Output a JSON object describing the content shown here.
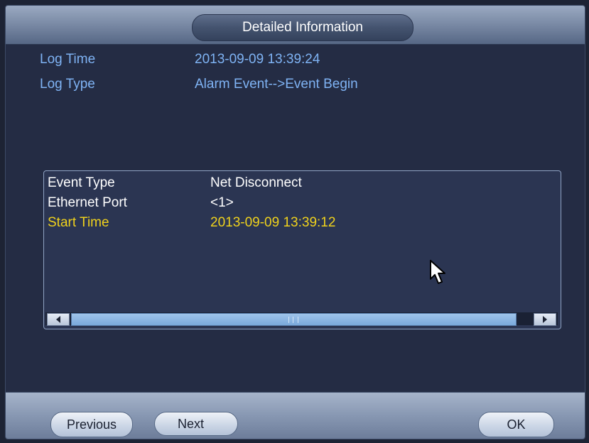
{
  "dialog": {
    "title": "Detailed Information"
  },
  "log_info": [
    {
      "label": "Log Time",
      "value": "2013-09-09 13:39:24"
    },
    {
      "label": "Log Type",
      "value": "Alarm Event-->Event Begin"
    }
  ],
  "details": [
    {
      "label": "Event Type",
      "value": "Net Disconnect",
      "highlighted": false
    },
    {
      "label": "Ethernet Port",
      "value": "<1>",
      "highlighted": false
    },
    {
      "label": "Start Time",
      "value": "2013-09-09 13:39:12",
      "highlighted": true
    }
  ],
  "scrollbar": {
    "left_icon": "arrow-left-icon",
    "right_icon": "arrow-right-icon"
  },
  "buttons": {
    "previous": "Previous",
    "next": "Next",
    "ok": "OK"
  },
  "colors": {
    "label_blue": "#7fb3f4",
    "highlight_yellow": "#f0d21c",
    "background": "#242c44"
  }
}
